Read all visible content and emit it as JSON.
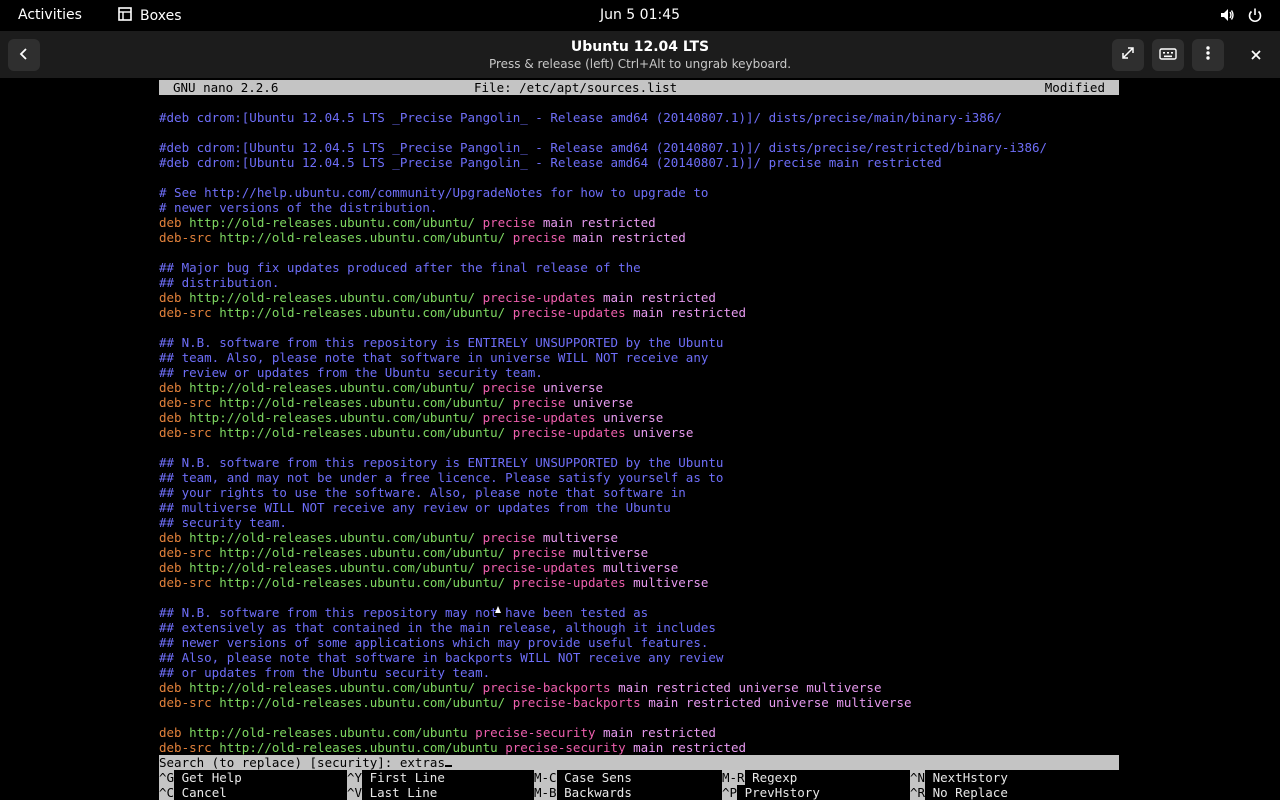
{
  "topbar": {
    "activities": "Activities",
    "app_name": "Boxes",
    "clock": "Jun 5  01:45"
  },
  "header": {
    "title": "Ubuntu 12.04 LTS",
    "subtitle": "Press & release (left) Ctrl+Alt to ungrab keyboard."
  },
  "nano": {
    "version": "GNU nano 2.2.6",
    "file": "File: /etc/apt/sources.list",
    "status": "Modified",
    "search_prompt": "Search (to replace) [security]: extras",
    "shortcuts": [
      {
        "key": "^G",
        "label": "Get Help"
      },
      {
        "key": "^C",
        "label": "Cancel"
      },
      {
        "key": "^Y",
        "label": "First Line"
      },
      {
        "key": "^V",
        "label": "Last Line"
      },
      {
        "key": "M-C",
        "label": "Case Sens"
      },
      {
        "key": "M-B",
        "label": "Backwards"
      },
      {
        "key": "M-R",
        "label": "Regexp"
      },
      {
        "key": "^P",
        "label": "PrevHstory"
      },
      {
        "key": "^N",
        "label": "NextHstory"
      },
      {
        "key": "^R",
        "label": "No Replace"
      }
    ]
  },
  "lines": [
    [
      {
        "t": "#deb cdrom:[Ubuntu 12.04.5 LTS _Precise Pangolin_ - Release amd64 (20140807.1)]/ dists/precise/main/binary-i386/",
        "c": "comment"
      }
    ],
    [],
    [
      {
        "t": "#deb cdrom:[Ubuntu 12.04.5 LTS _Precise Pangolin_ - Release amd64 (20140807.1)]/ dists/precise/restricted/binary-i386/",
        "c": "comment"
      }
    ],
    [
      {
        "t": "#deb cdrom:[Ubuntu 12.04.5 LTS _Precise Pangolin_ - Release amd64 (20140807.1)]/ precise main restricted",
        "c": "comment"
      }
    ],
    [],
    [
      {
        "t": "# See http://help.ubuntu.com/community/UpgradeNotes for how to upgrade to",
        "c": "comment"
      }
    ],
    [
      {
        "t": "# newer versions of the distribution.",
        "c": "comment"
      }
    ],
    [
      {
        "t": "deb ",
        "c": "deb"
      },
      {
        "t": "http://old-releases.ubuntu.com/ubuntu/ ",
        "c": "url"
      },
      {
        "t": "precise ",
        "c": "dist"
      },
      {
        "t": "main restricted",
        "c": "comp"
      }
    ],
    [
      {
        "t": "deb-src ",
        "c": "deb"
      },
      {
        "t": "http://old-releases.ubuntu.com/ubuntu/ ",
        "c": "url"
      },
      {
        "t": "precise ",
        "c": "dist"
      },
      {
        "t": "main restricted",
        "c": "comp"
      }
    ],
    [],
    [
      {
        "t": "## Major bug fix updates produced after the final release of the",
        "c": "comment"
      }
    ],
    [
      {
        "t": "## distribution.",
        "c": "comment"
      }
    ],
    [
      {
        "t": "deb ",
        "c": "deb"
      },
      {
        "t": "http://old-releases.ubuntu.com/ubuntu/ ",
        "c": "url"
      },
      {
        "t": "precise-updates ",
        "c": "dist"
      },
      {
        "t": "main restricted",
        "c": "comp"
      }
    ],
    [
      {
        "t": "deb-src ",
        "c": "deb"
      },
      {
        "t": "http://old-releases.ubuntu.com/ubuntu/ ",
        "c": "url"
      },
      {
        "t": "precise-updates ",
        "c": "dist"
      },
      {
        "t": "main restricted",
        "c": "comp"
      }
    ],
    [],
    [
      {
        "t": "## N.B. software from this repository is ENTIRELY UNSUPPORTED by the Ubuntu",
        "c": "comment"
      }
    ],
    [
      {
        "t": "## team. Also, please note that software in universe WILL NOT receive any",
        "c": "comment"
      }
    ],
    [
      {
        "t": "## review or updates from the Ubuntu security team.",
        "c": "comment"
      }
    ],
    [
      {
        "t": "deb ",
        "c": "deb"
      },
      {
        "t": "http://old-releases.ubuntu.com/ubuntu/ ",
        "c": "url"
      },
      {
        "t": "precise ",
        "c": "dist"
      },
      {
        "t": "universe",
        "c": "comp"
      }
    ],
    [
      {
        "t": "deb-src ",
        "c": "deb"
      },
      {
        "t": "http://old-releases.ubuntu.com/ubuntu/ ",
        "c": "url"
      },
      {
        "t": "precise ",
        "c": "dist"
      },
      {
        "t": "universe",
        "c": "comp"
      }
    ],
    [
      {
        "t": "deb ",
        "c": "deb"
      },
      {
        "t": "http://old-releases.ubuntu.com/ubuntu/ ",
        "c": "url"
      },
      {
        "t": "precise-updates ",
        "c": "dist"
      },
      {
        "t": "universe",
        "c": "comp"
      }
    ],
    [
      {
        "t": "deb-src ",
        "c": "deb"
      },
      {
        "t": "http://old-releases.ubuntu.com/ubuntu/ ",
        "c": "url"
      },
      {
        "t": "precise-updates ",
        "c": "dist"
      },
      {
        "t": "universe",
        "c": "comp"
      }
    ],
    [],
    [
      {
        "t": "## N.B. software from this repository is ENTIRELY UNSUPPORTED by the Ubuntu",
        "c": "comment"
      }
    ],
    [
      {
        "t": "## team, and may not be under a free licence. Please satisfy yourself as to",
        "c": "comment"
      }
    ],
    [
      {
        "t": "## your rights to use the software. Also, please note that software in",
        "c": "comment"
      }
    ],
    [
      {
        "t": "## multiverse WILL NOT receive any review or updates from the Ubuntu",
        "c": "comment"
      }
    ],
    [
      {
        "t": "## security team.",
        "c": "comment"
      }
    ],
    [
      {
        "t": "deb ",
        "c": "deb"
      },
      {
        "t": "http://old-releases.ubuntu.com/ubuntu/ ",
        "c": "url"
      },
      {
        "t": "precise ",
        "c": "dist"
      },
      {
        "t": "multiverse",
        "c": "comp"
      }
    ],
    [
      {
        "t": "deb-src ",
        "c": "deb"
      },
      {
        "t": "http://old-releases.ubuntu.com/ubuntu/ ",
        "c": "url"
      },
      {
        "t": "precise ",
        "c": "dist"
      },
      {
        "t": "multiverse",
        "c": "comp"
      }
    ],
    [
      {
        "t": "deb ",
        "c": "deb"
      },
      {
        "t": "http://old-releases.ubuntu.com/ubuntu/ ",
        "c": "url"
      },
      {
        "t": "precise-updates ",
        "c": "dist"
      },
      {
        "t": "multiverse",
        "c": "comp"
      }
    ],
    [
      {
        "t": "deb-src ",
        "c": "deb"
      },
      {
        "t": "http://old-releases.ubuntu.com/ubuntu/ ",
        "c": "url"
      },
      {
        "t": "precise-updates ",
        "c": "dist"
      },
      {
        "t": "multiverse",
        "c": "comp"
      }
    ],
    [],
    [
      {
        "t": "## N.B. software from this repository may not have been tested as",
        "c": "comment"
      }
    ],
    [
      {
        "t": "## extensively as that contained in the main release, although it includes",
        "c": "comment"
      }
    ],
    [
      {
        "t": "## newer versions of some applications which may provide useful features.",
        "c": "comment"
      }
    ],
    [
      {
        "t": "## Also, please note that software in backports WILL NOT receive any review",
        "c": "comment"
      }
    ],
    [
      {
        "t": "## or updates from the Ubuntu security team.",
        "c": "comment"
      }
    ],
    [
      {
        "t": "deb ",
        "c": "deb"
      },
      {
        "t": "http://old-releases.ubuntu.com/ubuntu/ ",
        "c": "url"
      },
      {
        "t": "precise-backports ",
        "c": "dist"
      },
      {
        "t": "main restricted universe multiverse",
        "c": "comp"
      }
    ],
    [
      {
        "t": "deb-src ",
        "c": "deb"
      },
      {
        "t": "http://old-releases.ubuntu.com/ubuntu/ ",
        "c": "url"
      },
      {
        "t": "precise-backports ",
        "c": "dist"
      },
      {
        "t": "main restricted universe multiverse",
        "c": "comp"
      }
    ],
    [],
    [
      {
        "t": "deb ",
        "c": "deb"
      },
      {
        "t": "http://old-releases.ubuntu.com/ubuntu ",
        "c": "url"
      },
      {
        "t": "precise-security ",
        "c": "dist"
      },
      {
        "t": "main restricted",
        "c": "comp"
      }
    ],
    [
      {
        "t": "deb-src ",
        "c": "deb"
      },
      {
        "t": "http://old-releases.ubuntu.com/ubuntu ",
        "c": "url"
      },
      {
        "t": "precise-security ",
        "c": "dist"
      },
      {
        "t": "main restricted",
        "c": "comp"
      }
    ]
  ]
}
